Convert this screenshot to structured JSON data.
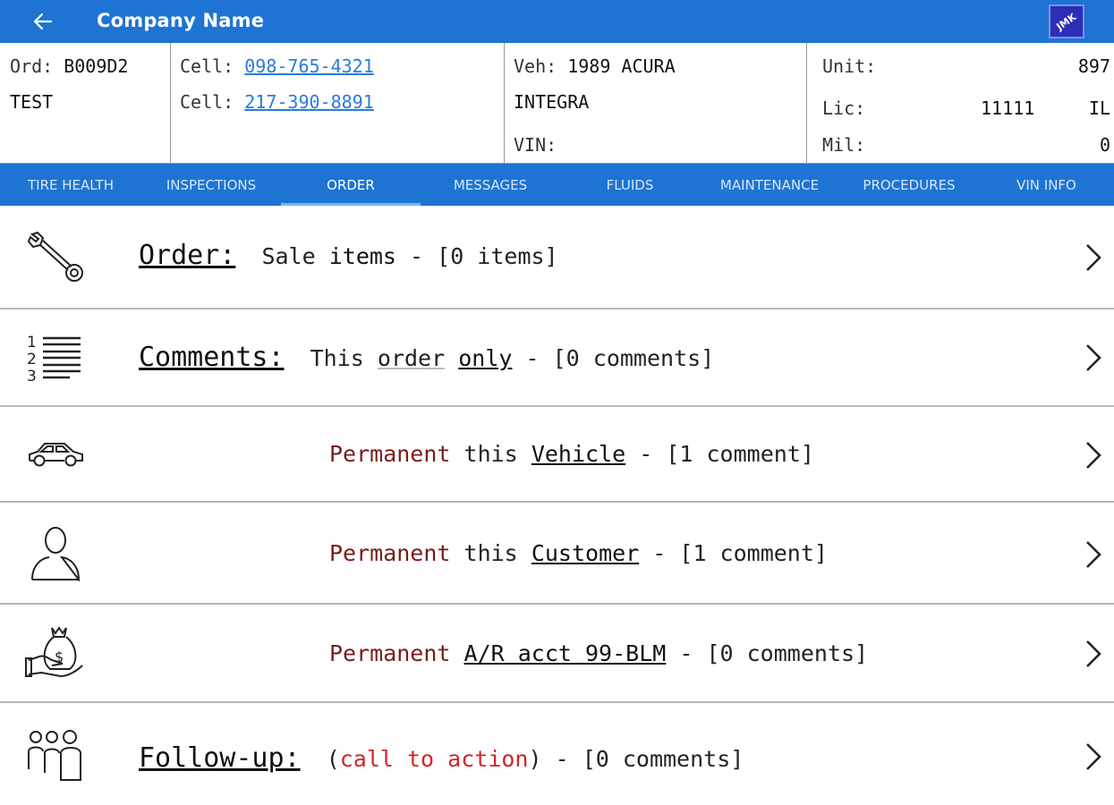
{
  "appbar": {
    "title": "Company Name",
    "logo_text": "JMK",
    "back_icon": "arrow-left-icon",
    "color": "#1e74d2"
  },
  "info": {
    "order": {
      "label": "Ord:",
      "value": "B009D2",
      "name": "TEST"
    },
    "cell1": {
      "label": "Cell:",
      "value": "098-765-4321"
    },
    "cell2": {
      "label": "Cell:",
      "value": "217-390-8891"
    },
    "vehicle": {
      "label": "Veh:",
      "value": "1989 ACURA",
      "model": "INTEGRA",
      "vin_label": "VIN:"
    },
    "unit": {
      "label": "Unit:",
      "value": "897"
    },
    "lic": {
      "label": "Lic:",
      "number": "11111",
      "state": "IL"
    },
    "mil": {
      "label": "Mil:",
      "value": "0"
    }
  },
  "tabs": [
    {
      "label": "TIRE HEALTH",
      "active": false
    },
    {
      "label": "INSPECTIONS",
      "active": false
    },
    {
      "label": "ORDER",
      "active": true
    },
    {
      "label": "MESSAGES",
      "active": false
    },
    {
      "label": "FLUIDS",
      "active": false
    },
    {
      "label": "MAINTENANCE",
      "active": false
    },
    {
      "label": "PROCEDURES",
      "active": false
    },
    {
      "label": "VIN INFO",
      "active": false
    }
  ],
  "rows": {
    "order": {
      "head": "Order:",
      "a": "Sale",
      "b": "items",
      "c": "- [0 items]",
      "icon": "wrench-icon"
    },
    "comments": {
      "head": "Comments:",
      "a": "This",
      "b": "order",
      "c": "only",
      "d": "- [0 comments]",
      "icon": "numbered-list-icon"
    },
    "vehicle": {
      "perm": "Permanent",
      "a": "this",
      "b": "Vehicle",
      "c": "- [1 comment]",
      "icon": "car-icon"
    },
    "customer": {
      "perm": "Permanent",
      "a": "this",
      "b": "Customer",
      "c": "- [1 comment]",
      "icon": "person-icon"
    },
    "ar": {
      "perm": "Permanent",
      "b": "A/R acct 99-BLM",
      "c": "- [0 comments]",
      "icon": "money-bag-hand-icon"
    },
    "followup": {
      "head": "Follow-up:",
      "open": "(",
      "cta": "call to action",
      "close": ")",
      "c": "- [0 comments]",
      "icon": "people-group-icon"
    }
  },
  "colors": {
    "permanent": "#7a1b1b",
    "call_to_action": "#d4232b",
    "link": "#2a7bdc"
  }
}
